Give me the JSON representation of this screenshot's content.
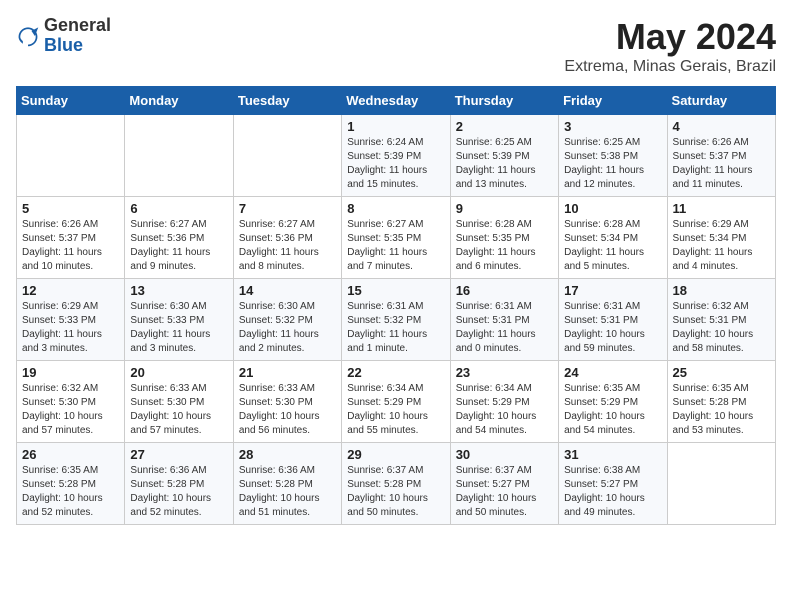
{
  "header": {
    "logo_general": "General",
    "logo_blue": "Blue",
    "month_year": "May 2024",
    "location": "Extrema, Minas Gerais, Brazil"
  },
  "days_of_week": [
    "Sunday",
    "Monday",
    "Tuesday",
    "Wednesday",
    "Thursday",
    "Friday",
    "Saturday"
  ],
  "weeks": [
    [
      {
        "day": "",
        "info": ""
      },
      {
        "day": "",
        "info": ""
      },
      {
        "day": "",
        "info": ""
      },
      {
        "day": "1",
        "info": "Sunrise: 6:24 AM\nSunset: 5:39 PM\nDaylight: 11 hours\nand 15 minutes."
      },
      {
        "day": "2",
        "info": "Sunrise: 6:25 AM\nSunset: 5:39 PM\nDaylight: 11 hours\nand 13 minutes."
      },
      {
        "day": "3",
        "info": "Sunrise: 6:25 AM\nSunset: 5:38 PM\nDaylight: 11 hours\nand 12 minutes."
      },
      {
        "day": "4",
        "info": "Sunrise: 6:26 AM\nSunset: 5:37 PM\nDaylight: 11 hours\nand 11 minutes."
      }
    ],
    [
      {
        "day": "5",
        "info": "Sunrise: 6:26 AM\nSunset: 5:37 PM\nDaylight: 11 hours\nand 10 minutes."
      },
      {
        "day": "6",
        "info": "Sunrise: 6:27 AM\nSunset: 5:36 PM\nDaylight: 11 hours\nand 9 minutes."
      },
      {
        "day": "7",
        "info": "Sunrise: 6:27 AM\nSunset: 5:36 PM\nDaylight: 11 hours\nand 8 minutes."
      },
      {
        "day": "8",
        "info": "Sunrise: 6:27 AM\nSunset: 5:35 PM\nDaylight: 11 hours\nand 7 minutes."
      },
      {
        "day": "9",
        "info": "Sunrise: 6:28 AM\nSunset: 5:35 PM\nDaylight: 11 hours\nand 6 minutes."
      },
      {
        "day": "10",
        "info": "Sunrise: 6:28 AM\nSunset: 5:34 PM\nDaylight: 11 hours\nand 5 minutes."
      },
      {
        "day": "11",
        "info": "Sunrise: 6:29 AM\nSunset: 5:34 PM\nDaylight: 11 hours\nand 4 minutes."
      }
    ],
    [
      {
        "day": "12",
        "info": "Sunrise: 6:29 AM\nSunset: 5:33 PM\nDaylight: 11 hours\nand 3 minutes."
      },
      {
        "day": "13",
        "info": "Sunrise: 6:30 AM\nSunset: 5:33 PM\nDaylight: 11 hours\nand 3 minutes."
      },
      {
        "day": "14",
        "info": "Sunrise: 6:30 AM\nSunset: 5:32 PM\nDaylight: 11 hours\nand 2 minutes."
      },
      {
        "day": "15",
        "info": "Sunrise: 6:31 AM\nSunset: 5:32 PM\nDaylight: 11 hours\nand 1 minute."
      },
      {
        "day": "16",
        "info": "Sunrise: 6:31 AM\nSunset: 5:31 PM\nDaylight: 11 hours\nand 0 minutes."
      },
      {
        "day": "17",
        "info": "Sunrise: 6:31 AM\nSunset: 5:31 PM\nDaylight: 10 hours\nand 59 minutes."
      },
      {
        "day": "18",
        "info": "Sunrise: 6:32 AM\nSunset: 5:31 PM\nDaylight: 10 hours\nand 58 minutes."
      }
    ],
    [
      {
        "day": "19",
        "info": "Sunrise: 6:32 AM\nSunset: 5:30 PM\nDaylight: 10 hours\nand 57 minutes."
      },
      {
        "day": "20",
        "info": "Sunrise: 6:33 AM\nSunset: 5:30 PM\nDaylight: 10 hours\nand 57 minutes."
      },
      {
        "day": "21",
        "info": "Sunrise: 6:33 AM\nSunset: 5:30 PM\nDaylight: 10 hours\nand 56 minutes."
      },
      {
        "day": "22",
        "info": "Sunrise: 6:34 AM\nSunset: 5:29 PM\nDaylight: 10 hours\nand 55 minutes."
      },
      {
        "day": "23",
        "info": "Sunrise: 6:34 AM\nSunset: 5:29 PM\nDaylight: 10 hours\nand 54 minutes."
      },
      {
        "day": "24",
        "info": "Sunrise: 6:35 AM\nSunset: 5:29 PM\nDaylight: 10 hours\nand 54 minutes."
      },
      {
        "day": "25",
        "info": "Sunrise: 6:35 AM\nSunset: 5:28 PM\nDaylight: 10 hours\nand 53 minutes."
      }
    ],
    [
      {
        "day": "26",
        "info": "Sunrise: 6:35 AM\nSunset: 5:28 PM\nDaylight: 10 hours\nand 52 minutes."
      },
      {
        "day": "27",
        "info": "Sunrise: 6:36 AM\nSunset: 5:28 PM\nDaylight: 10 hours\nand 52 minutes."
      },
      {
        "day": "28",
        "info": "Sunrise: 6:36 AM\nSunset: 5:28 PM\nDaylight: 10 hours\nand 51 minutes."
      },
      {
        "day": "29",
        "info": "Sunrise: 6:37 AM\nSunset: 5:28 PM\nDaylight: 10 hours\nand 50 minutes."
      },
      {
        "day": "30",
        "info": "Sunrise: 6:37 AM\nSunset: 5:27 PM\nDaylight: 10 hours\nand 50 minutes."
      },
      {
        "day": "31",
        "info": "Sunrise: 6:38 AM\nSunset: 5:27 PM\nDaylight: 10 hours\nand 49 minutes."
      },
      {
        "day": "",
        "info": ""
      }
    ]
  ]
}
